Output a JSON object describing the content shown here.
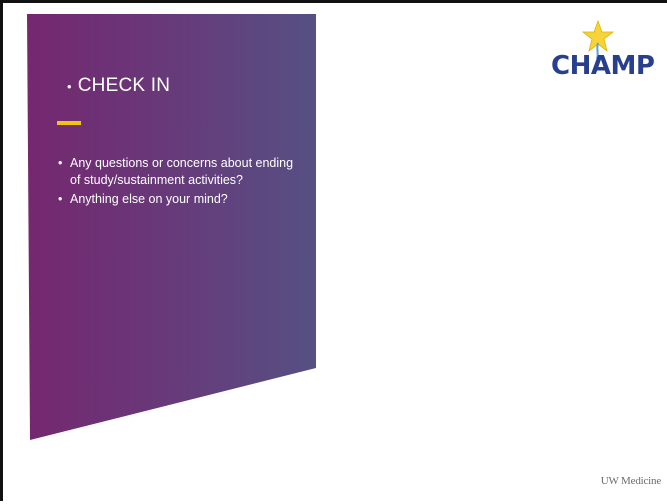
{
  "slide": {
    "title": "CHECK IN",
    "bullets": [
      "Any questions or concerns about ending of study/sustainment activities?",
      "Anything else on your mind?"
    ]
  },
  "logo": {
    "text": "CHAMP",
    "star_color": "#f5d33a",
    "text_color": "#283f8e"
  },
  "footer": {
    "text": "UW Medicine"
  },
  "colors": {
    "panel_gradient_start": "#75276f",
    "panel_gradient_end": "#565083",
    "accent": "#f2c314"
  }
}
